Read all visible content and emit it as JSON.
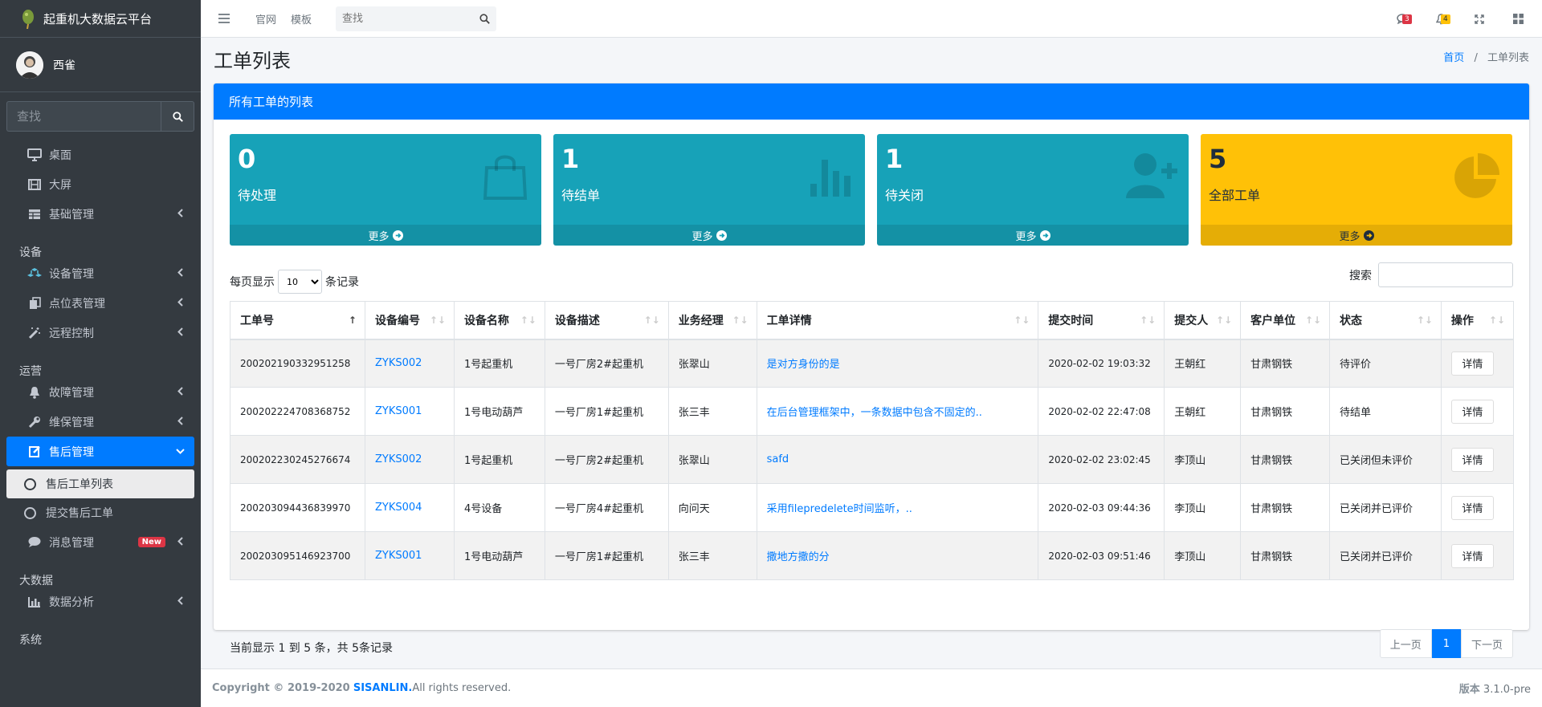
{
  "brand": {
    "title": "起重机大数据云平台"
  },
  "user": {
    "name": "西雀"
  },
  "sidebar": {
    "search_placeholder": "查找",
    "items": [
      {
        "label": "桌面",
        "icon": "desktop-icon"
      },
      {
        "label": "大屏",
        "icon": "film-icon"
      },
      {
        "label": "基础管理",
        "icon": "table-icon"
      }
    ],
    "section_equipment": "设备",
    "equipment_items": [
      {
        "label": "设备管理",
        "icon": "cubes-icon"
      },
      {
        "label": "点位表管理",
        "icon": "copy-icon"
      },
      {
        "label": "远程控制",
        "icon": "magic-icon"
      }
    ],
    "section_ops": "运营",
    "ops_items": [
      {
        "label": "故障管理",
        "icon": "bell-icon"
      },
      {
        "label": "维保管理",
        "icon": "wrench-icon"
      },
      {
        "label": "售后管理",
        "icon": "edit-icon"
      }
    ],
    "sub_items": [
      {
        "label": "售后工单列表"
      },
      {
        "label": "提交售后工单"
      }
    ],
    "message": {
      "label": "消息管理",
      "badge": "New"
    },
    "section_bigdata": "大数据",
    "data_analysis": "数据分析",
    "section_system": "系统"
  },
  "topbar": {
    "links": [
      "官网",
      "模板"
    ],
    "search_placeholder": "查找",
    "messages_count": "3",
    "notifications_count": "4"
  },
  "page": {
    "title": "工单列表",
    "breadcrumb": {
      "home": "首页",
      "sep": "/",
      "current": "工单列表"
    }
  },
  "card": {
    "header": "所有工单的列表"
  },
  "stats": [
    {
      "value": "0",
      "label": "待处理",
      "more": "更多",
      "color": "#17a2b8",
      "icon": "shopping-bag-icon"
    },
    {
      "value": "1",
      "label": "待结单",
      "more": "更多",
      "color": "#17a2b8",
      "icon": "bar-chart-icon"
    },
    {
      "value": "1",
      "label": "待关闭",
      "more": "更多",
      "color": "#17a2b8",
      "icon": "user-plus-icon"
    },
    {
      "value": "5",
      "label": "全部工单",
      "more": "更多",
      "color": "#ffc107",
      "icon": "pie-chart-icon"
    }
  ],
  "table_controls": {
    "show_prefix": "每页显示",
    "page_size": "10",
    "show_suffix": "条记录",
    "search_label": "搜索"
  },
  "table": {
    "columns": [
      "工单号",
      "设备编号",
      "设备名称",
      "设备描述",
      "业务经理",
      "工单详情",
      "提交时间",
      "提交人",
      "客户单位",
      "状态",
      "操作"
    ],
    "rows": [
      {
        "id": "200202190332951258",
        "code": "ZYKS002",
        "name": "1号起重机",
        "desc": "一号厂房2#起重机",
        "manager": "张翠山",
        "detail": "是对方身份的是",
        "time": "2020-02-02 19:03:32",
        "submitter": "王朝红",
        "client": "甘肃钢铁",
        "status": "待评价",
        "action": "详情"
      },
      {
        "id": "200202224708368752",
        "code": "ZYKS001",
        "name": "1号电动葫芦",
        "desc": "一号厂房1#起重机",
        "manager": "张三丰",
        "detail": "在后台管理框架中，一条数据中包含不固定的..",
        "time": "2020-02-02 22:47:08",
        "submitter": "王朝红",
        "client": "甘肃钢铁",
        "status": "待结单",
        "action": "详情"
      },
      {
        "id": "200202230245276674",
        "code": "ZYKS002",
        "name": "1号起重机",
        "desc": "一号厂房2#起重机",
        "manager": "张翠山",
        "detail": "safd",
        "time": "2020-02-02 23:02:45",
        "submitter": "李顶山",
        "client": "甘肃钢铁",
        "status": "已关闭但未评价",
        "action": "详情"
      },
      {
        "id": "200203094436839970",
        "code": "ZYKS004",
        "name": "4号设备",
        "desc": "一号厂房4#起重机",
        "manager": "向问天",
        "detail": "采用filepredelete时间监听，..",
        "time": "2020-02-03 09:44:36",
        "submitter": "李顶山",
        "client": "甘肃钢铁",
        "status": "已关闭并已评价",
        "action": "详情"
      },
      {
        "id": "200203095146923700",
        "code": "ZYKS001",
        "name": "1号电动葫芦",
        "desc": "一号厂房1#起重机",
        "manager": "张三丰",
        "detail": "撒地方撒的分",
        "time": "2020-02-03 09:51:46",
        "submitter": "李顶山",
        "client": "甘肃钢铁",
        "status": "已关闭并已评价",
        "action": "详情"
      }
    ]
  },
  "pagination": {
    "info": "当前显示 1 到 5 条，共 5条记录",
    "prev": "上一页",
    "current": "1",
    "next": "下一页"
  },
  "footer": {
    "copyright": "Copyright © 2019-2020",
    "site": "SISANLIN.",
    "rights": " All rights reserved.",
    "version_label": "版本",
    "version": "3.1.0-pre"
  }
}
